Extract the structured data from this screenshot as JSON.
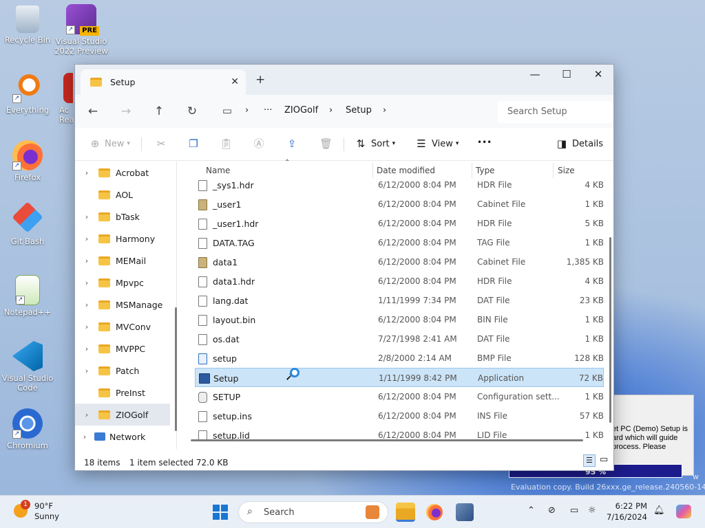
{
  "desktop": {
    "icons": [
      {
        "label": "Recycle Bin",
        "icon": "recycle-bin-icon"
      },
      {
        "label": "Visual Studio 2022 Preview",
        "icon": "visual-studio-preview-icon",
        "badge": "PRE"
      },
      {
        "label": "Everything",
        "icon": "everything-search-icon"
      },
      {
        "label": "Ac Rea",
        "icon": "acrobat-reader-icon"
      },
      {
        "label": "Firefox",
        "icon": "firefox-icon"
      },
      {
        "label": "Git Bash",
        "icon": "git-bash-icon"
      },
      {
        "label": "Notepad++",
        "icon": "notepad-plus-plus-icon"
      },
      {
        "label": "Visual Studio Code",
        "icon": "vscode-icon"
      },
      {
        "label": "Chromium",
        "icon": "chromium-icon"
      }
    ],
    "installer_text": "et PC (Demo) Setup is\nard which will guide\nprocess.  Please",
    "installer_progress": "95 %",
    "eval_text": "Evaluation copy. Build 26xxx.ge_release.240560-1400",
    "eval_text_short": "w"
  },
  "explorer": {
    "tab_title": "Setup",
    "new_tab": "+",
    "controls": {
      "minimize": "—",
      "maximize": "☐",
      "close": "✕"
    },
    "breadcrumb": [
      "ZIOGolf",
      "Setup"
    ],
    "breadcrumb_ellipsis": "···",
    "search_placeholder": "Search Setup",
    "toolbar": {
      "new_label": "New",
      "sort_label": "Sort",
      "view_label": "View",
      "more_label": "•••",
      "details_label": "Details"
    },
    "nav_tree": [
      {
        "label": "Acrobat",
        "expandable": true
      },
      {
        "label": "AOL",
        "expandable": false
      },
      {
        "label": "bTask",
        "expandable": true
      },
      {
        "label": "Harmony",
        "expandable": true
      },
      {
        "label": "MEMail",
        "expandable": true
      },
      {
        "label": "Mpvpc",
        "expandable": true
      },
      {
        "label": "MSManage",
        "expandable": true
      },
      {
        "label": "MVConv",
        "expandable": true
      },
      {
        "label": "MVPPC",
        "expandable": true
      },
      {
        "label": "Patch",
        "expandable": true
      },
      {
        "label": "PreInst",
        "expandable": false
      },
      {
        "label": "ZIOGolf",
        "expandable": true,
        "selected": true
      },
      {
        "label": "Network",
        "expandable": true
      }
    ],
    "columns": {
      "name": "Name",
      "date": "Date modified",
      "type": "Type",
      "size": "Size"
    },
    "files": [
      {
        "name": "_sys1.hdr",
        "date": "6/12/2000 8:04 PM",
        "type": "HDR File",
        "size": "4 KB",
        "icon": "generic"
      },
      {
        "name": "_user1",
        "date": "6/12/2000 8:04 PM",
        "type": "Cabinet File",
        "size": "1 KB",
        "icon": "cab"
      },
      {
        "name": "_user1.hdr",
        "date": "6/12/2000 8:04 PM",
        "type": "HDR File",
        "size": "5 KB",
        "icon": "generic"
      },
      {
        "name": "DATA.TAG",
        "date": "6/12/2000 8:04 PM",
        "type": "TAG File",
        "size": "1 KB",
        "icon": "generic"
      },
      {
        "name": "data1",
        "date": "6/12/2000 8:04 PM",
        "type": "Cabinet File",
        "size": "1,385 KB",
        "icon": "cab"
      },
      {
        "name": "data1.hdr",
        "date": "6/12/2000 8:04 PM",
        "type": "HDR File",
        "size": "4 KB",
        "icon": "generic"
      },
      {
        "name": "lang.dat",
        "date": "1/11/1999 7:34 PM",
        "type": "DAT File",
        "size": "23 KB",
        "icon": "generic"
      },
      {
        "name": "layout.bin",
        "date": "6/12/2000 8:04 PM",
        "type": "BIN File",
        "size": "1 KB",
        "icon": "generic"
      },
      {
        "name": "os.dat",
        "date": "7/27/1998 2:41 AM",
        "type": "DAT File",
        "size": "1 KB",
        "icon": "generic"
      },
      {
        "name": "setup",
        "date": "2/8/2000 2:14 AM",
        "type": "BMP File",
        "size": "128 KB",
        "icon": "bmp"
      },
      {
        "name": "Setup",
        "date": "1/11/1999 8:42 PM",
        "type": "Application",
        "size": "72 KB",
        "icon": "app",
        "selected": true
      },
      {
        "name": "SETUP",
        "date": "6/12/2000 8:04 PM",
        "type": "Configuration sett...",
        "size": "1 KB",
        "icon": "cfg"
      },
      {
        "name": "setup.ins",
        "date": "6/12/2000 8:04 PM",
        "type": "INS File",
        "size": "57 KB",
        "icon": "generic"
      },
      {
        "name": "setup.lid",
        "date": "6/12/2000 8:04 PM",
        "type": "LID File",
        "size": "1 KB",
        "icon": "generic"
      }
    ],
    "status": {
      "item_count": "18 items",
      "selection": "1 item selected  72.0 KB"
    }
  },
  "taskbar": {
    "weather_temp": "90°F",
    "weather_desc": "Sunny",
    "weather_badge": "1",
    "search_placeholder": "Search",
    "time": "6:22 PM",
    "date": "7/16/2024"
  }
}
